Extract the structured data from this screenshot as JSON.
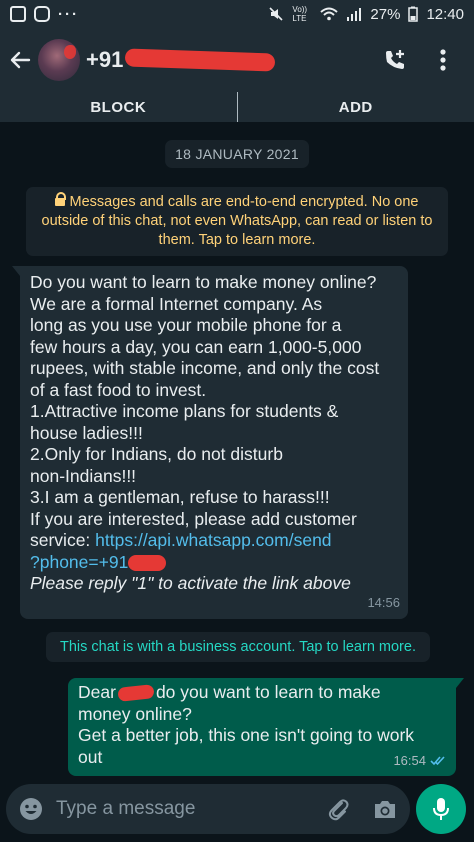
{
  "status_bar": {
    "left_icons": [
      "app-icon",
      "instagram-icon"
    ],
    "dots": "···",
    "volte": "Vo)) LTE",
    "battery": "27%",
    "time": "12:40"
  },
  "header": {
    "contact_prefix": "+91",
    "icons": [
      "back-arrow-icon",
      "add-call-icon",
      "more-vertical-icon"
    ]
  },
  "action_bar": {
    "block_label": "BLOCK",
    "add_label": "ADD"
  },
  "chat": {
    "date_chip": "18 JANUARY 2021",
    "encryption_notice": "Messages and calls are end-to-end encrypted. No one outside of this chat, not even WhatsApp, can read or listen to them. Tap to learn more.",
    "incoming": {
      "lines": [
        "Do you want to learn to make money online?",
        "We are a formal Internet company. As",
        "long as you use your mobile phone for a",
        "few hours a day, you can earn 1,000-5,000",
        "rupees, with stable income, and only the cost",
        "of a fast food to invest.",
        "1.Attractive income plans for students &",
        "house ladies!!!",
        "2.Only for Indians, do not disturb",
        "non-Indians!!!",
        "3.I am a gentleman, refuse to harass!!!",
        "If you are interested, please add customer"
      ],
      "service_label": "service: ",
      "link_part1": "https://api.whatsapp.com/send",
      "link_part2": "?phone=+91",
      "italic_line": "Please reply \"1\" to activate the link above",
      "time": "14:56"
    },
    "business_notice": "This chat is with a business account. Tap to learn more.",
    "outgoing": {
      "greeting": "Dear",
      "line1_rest": "do you want to learn to make",
      "line2": "money online?",
      "line3": "Get a better job, this one isn't going to work",
      "line4": "out",
      "time": "16:54",
      "status": "read"
    }
  },
  "composer": {
    "placeholder": "Type a message",
    "icons": [
      "emoji-icon",
      "attach-icon",
      "camera-icon",
      "mic-icon"
    ]
  },
  "colors": {
    "background": "#0b141a",
    "bar": "#1f2c34",
    "incoming_bubble": "#1f2c34",
    "outgoing_bubble": "#005c4b",
    "accent": "#00a884",
    "link": "#53bdeb",
    "notice_yellow": "#ffd279",
    "notice_teal": "#25d8c4",
    "redaction": "#e53935"
  }
}
